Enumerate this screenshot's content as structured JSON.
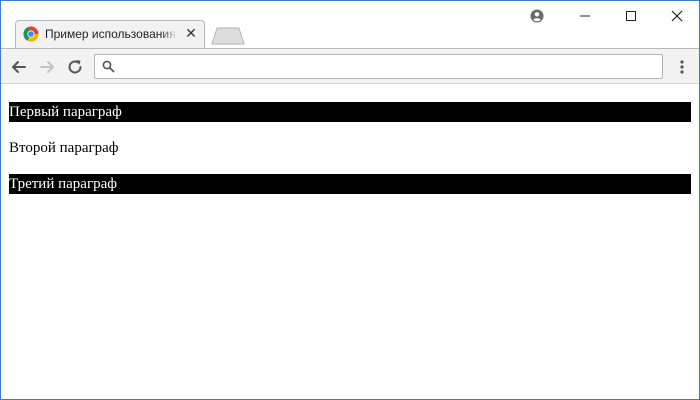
{
  "window": {
    "controls": {
      "profile_icon": "account-circle-icon",
      "minimize_icon": "minimize-icon",
      "maximize_icon": "maximize-icon",
      "close_icon": "close-icon"
    }
  },
  "tabs": [
    {
      "title": "Пример использования",
      "favicon": "chrome-favicon-icon",
      "close_icon": "close-icon",
      "active": true
    }
  ],
  "toolbar": {
    "back_icon": "arrow-left-icon",
    "forward_icon": "arrow-right-icon",
    "reload_icon": "reload-icon",
    "menu_icon": "kebab-menu-icon",
    "omnibox": {
      "search_icon": "search-icon",
      "value": "",
      "placeholder": ""
    }
  },
  "page": {
    "paragraphs": [
      {
        "text": "Первый параграф",
        "background": "#000000",
        "color": "#ffffff"
      },
      {
        "text": "Второй параграф",
        "background": "#ffffff",
        "color": "#000000"
      },
      {
        "text": "Третий параграф",
        "background": "#000000",
        "color": "#ffffff"
      }
    ]
  },
  "colors": {
    "window_border": "#3a7bd5",
    "toolbar_bg": "#f2f2f2",
    "tab_bg": "#f2f2f2"
  }
}
